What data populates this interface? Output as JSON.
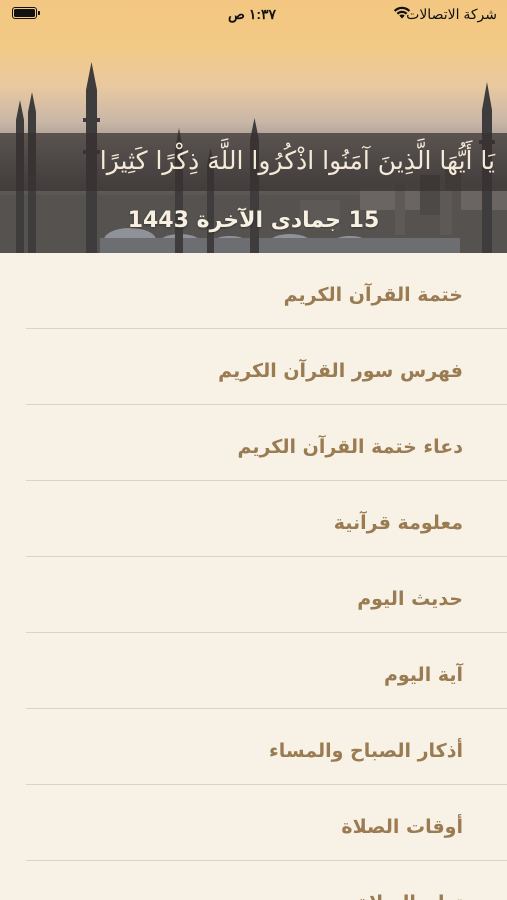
{
  "status_bar": {
    "carrier": "شركة الاتصالات",
    "time": "١:٣٧ ص"
  },
  "header": {
    "ayah": "يَا أَيُّهَا الَّذِينَ آمَنُوا اذْكُرُوا اللَّهَ ذِكْرًا كَثِيرًا",
    "hijri_date": "15 جمادى الآخرة 1443"
  },
  "menu": {
    "items": [
      {
        "label": "ختمة القرآن الكريم"
      },
      {
        "label": "فهرس سور القرآن الكريم"
      },
      {
        "label": "دعاء ختمة القرآن الكريم"
      },
      {
        "label": "معلومة قرآنية"
      },
      {
        "label": "حديث اليوم"
      },
      {
        "label": "آية  اليوم"
      },
      {
        "label": "أذكار الصباح والمساء"
      },
      {
        "label": "أوقات الصلاة"
      },
      {
        "label": "تعلم الصلاة"
      }
    ]
  },
  "colors": {
    "background": "#f8f2e6",
    "menu_text": "#9a7b52",
    "divider": "#ddd3c4",
    "band": "#373230"
  }
}
